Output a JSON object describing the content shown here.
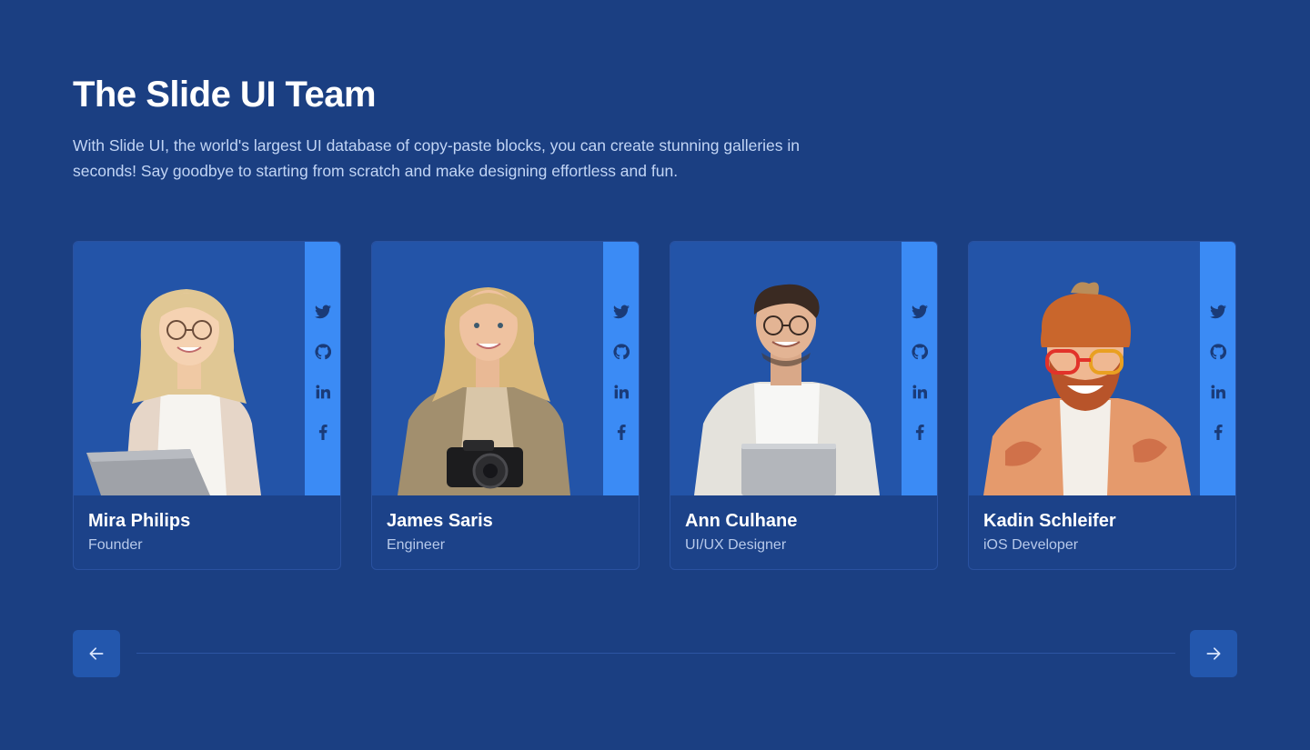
{
  "section": {
    "title": "The Slide UI Team",
    "description": "With Slide UI, the world's largest UI database of copy-paste blocks, you can create stunning galleries in seconds! Say goodbye to starting from scratch and make designing effortless and fun."
  },
  "team": [
    {
      "name": "Mira Philips",
      "role": "Founder"
    },
    {
      "name": "James Saris",
      "role": "Engineer"
    },
    {
      "name": "Ann Culhane",
      "role": "UI/UX Designer"
    },
    {
      "name": "Kadin Schleifer",
      "role": "iOS Developer"
    }
  ],
  "social_icons": [
    "twitter-icon",
    "github-icon",
    "linkedin-icon",
    "facebook-icon"
  ],
  "navigation": {
    "prev_icon": "arrow-left-icon",
    "next_icon": "arrow-right-icon"
  },
  "colors": {
    "background": "#1b3f82",
    "card_media": "#2354a8",
    "social_bar": "#3b8bf5",
    "nav_button": "#2357ad"
  }
}
